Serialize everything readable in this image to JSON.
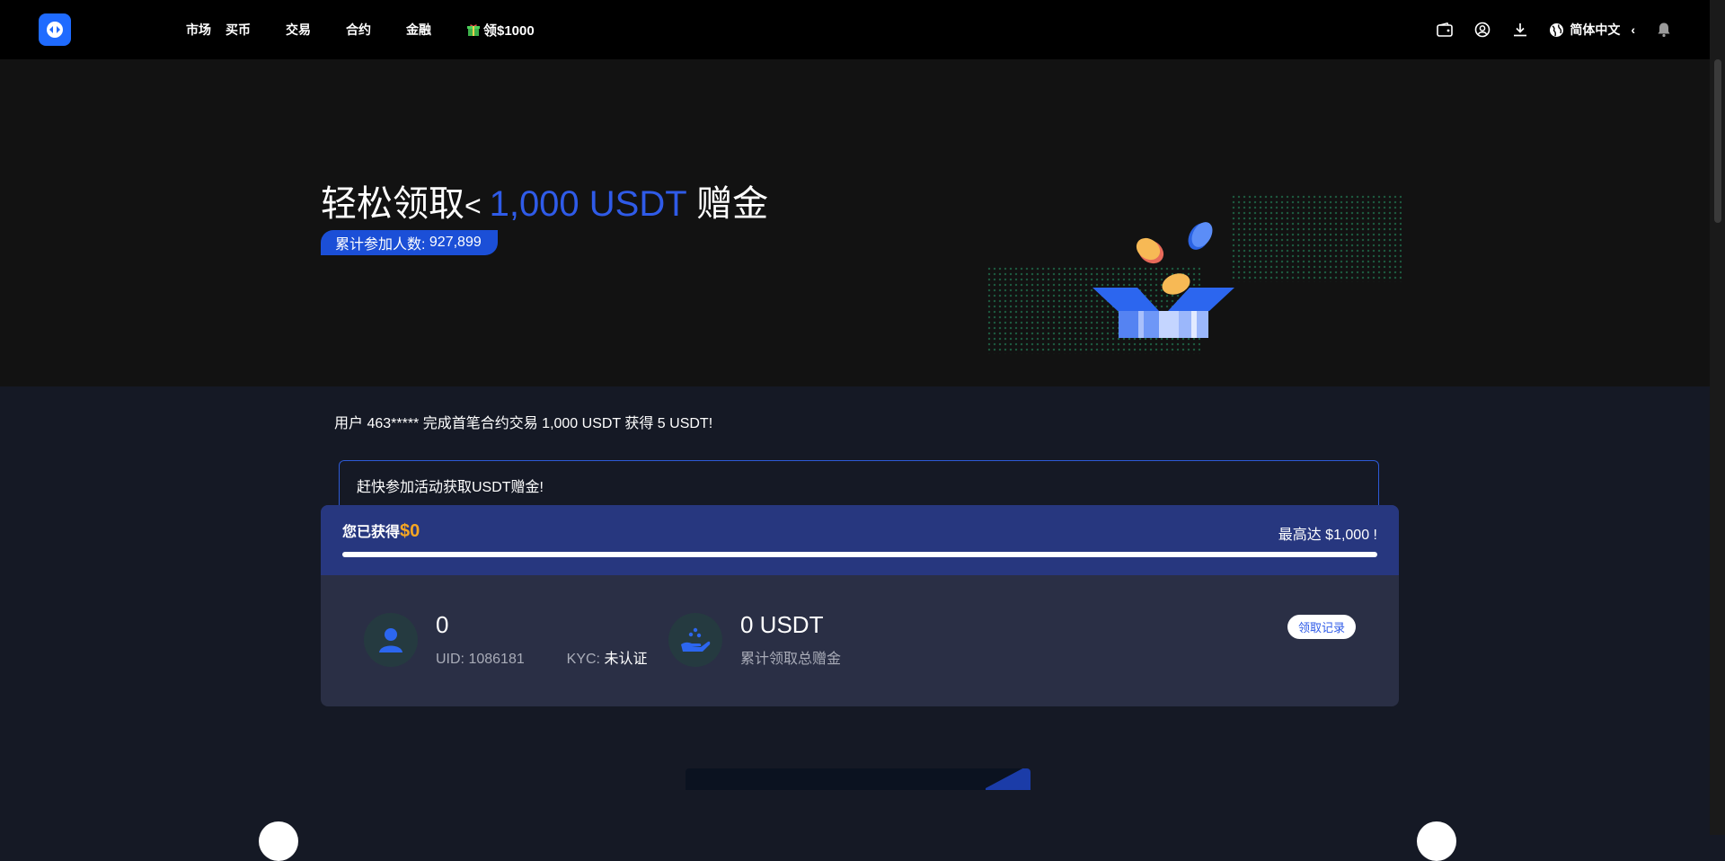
{
  "header": {
    "nav": [
      {
        "id": "market",
        "label": "市场"
      },
      {
        "id": "buy",
        "label": "买币"
      },
      {
        "id": "trade",
        "label": "交易"
      },
      {
        "id": "futures",
        "label": "合约"
      },
      {
        "id": "finance",
        "label": "金融"
      }
    ],
    "promo_label": "领$1000",
    "language": "简体中文"
  },
  "hero": {
    "title_prefix": "轻松领取",
    "title_lt": "< ",
    "title_amount": "1,000 USDT",
    "title_suffix": " 赠金",
    "participants_label": "累计参加人数:",
    "participants_count": "927,899"
  },
  "ticker": {
    "message": "用户 463***** 完成首笔合约交易 1,000 USDT 获得 5 USDT!"
  },
  "notice": {
    "text": "赶快参加活动获取USDT赠金!"
  },
  "reward": {
    "earned_label": "您已获得",
    "earned_amount": "$0",
    "max_label": "最高达 $1,000 !",
    "progress_fraction": 0,
    "user": {
      "count": "0",
      "uid": "UID: 1086181",
      "kyc_label": "KYC: ",
      "kyc_status": "未认证"
    },
    "bonus": {
      "total": "0 USDT",
      "label": "累计领取总赠金"
    },
    "record_button": "领取记录"
  },
  "colors": {
    "accent": "#2f5be8",
    "gold": "#f5a623",
    "header_bg": "#000000",
    "page_bg": "#151925"
  }
}
